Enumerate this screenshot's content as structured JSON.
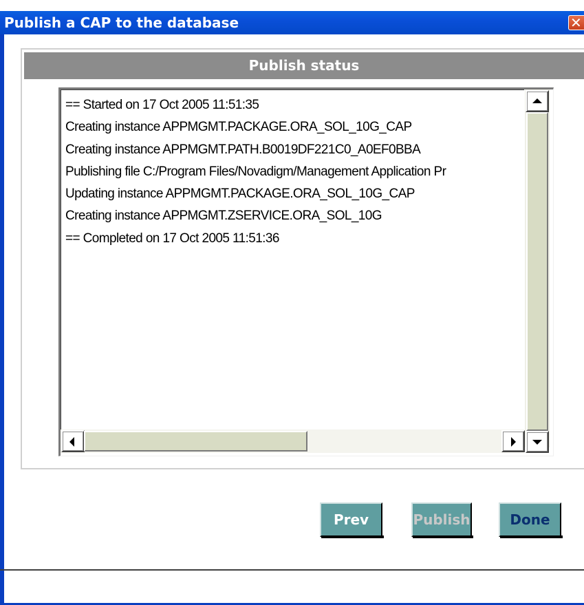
{
  "window": {
    "title": "Publish a CAP to the database",
    "close_glyph": "✕"
  },
  "panel": {
    "header": "Publish status"
  },
  "log": {
    "lines": [
      "== Started on 17 Oct 2005 11:51:35",
      "Creating instance APPMGMT.PACKAGE.ORA_SOL_10G_CAP",
      "Creating instance APPMGMT.PATH.B0019DF221C0_A0EF0BBA",
      "Publishing file C:/Program Files/Novadigm/Management Application Pr",
      "Updating instance APPMGMT.PACKAGE.ORA_SOL_10G_CAP",
      "Creating instance APPMGMT.ZSERVICE.ORA_SOL_10G",
      "== Completed on 17 Oct 2005 11:51:36"
    ]
  },
  "buttons": {
    "prev": "Prev",
    "publish": "Publish",
    "done": "Done"
  },
  "colors": {
    "titlebar": "#0a4fd8",
    "button_face": "#5f9ea0",
    "panel_header": "#8c8c8c"
  }
}
